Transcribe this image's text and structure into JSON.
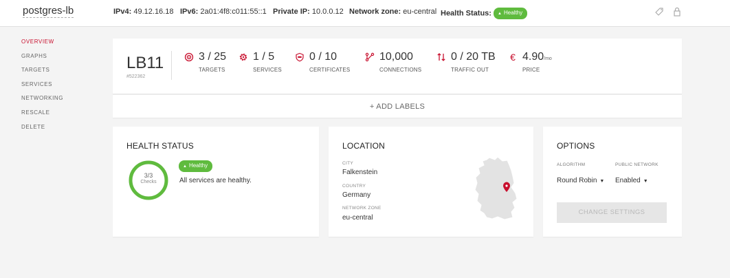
{
  "header": {
    "name": "postgres-lb",
    "ipv4_label": "IPv4:",
    "ipv4": "49.12.16.18",
    "ipv6_label": "IPv6:",
    "ipv6": "2a01:4f8:c011:55::1",
    "private_ip_label": "Private IP:",
    "private_ip": "10.0.0.12",
    "network_zone_label": "Network zone:",
    "network_zone": "eu-central",
    "health_label": "Health Status:",
    "health": "Healthy",
    "icons": [
      "label-icon",
      "lock-icon"
    ]
  },
  "sidebar": {
    "items": [
      {
        "label": "OVERVIEW",
        "active": true
      },
      {
        "label": "GRAPHS"
      },
      {
        "label": "TARGETS"
      },
      {
        "label": "SERVICES"
      },
      {
        "label": "NETWORKING"
      },
      {
        "label": "RESCALE"
      },
      {
        "label": "DELETE"
      }
    ]
  },
  "summary": {
    "type": "LB11",
    "id": "#522362",
    "stats": [
      {
        "value": "3 / 25",
        "label": "TARGETS",
        "icon": "target-icon"
      },
      {
        "value": "1 / 5",
        "label": "SERVICES",
        "icon": "services-gear-icon"
      },
      {
        "value": "0 / 10",
        "label": "CERTIFICATES",
        "icon": "certificate-shield-icon"
      },
      {
        "value": "10,000",
        "label": "CONNECTIONS",
        "icon": "connections-icon"
      },
      {
        "value": "0 / 20 TB",
        "label": "TRAFFIC OUT",
        "icon": "traffic-arrows-icon"
      },
      {
        "value": "4.90",
        "unit": "/mo",
        "label": "PRICE",
        "icon": "euro-icon"
      }
    ]
  },
  "labels": {
    "add": "+ ADD LABELS"
  },
  "health": {
    "title": "HEALTH STATUS",
    "ring_value": "3/3",
    "ring_sub": "Checks",
    "ring_fraction": 1,
    "badge": "Healthy",
    "message": "All services are healthy."
  },
  "location": {
    "title": "LOCATION",
    "city_label": "CITY",
    "city": "Falkenstein",
    "country_label": "COUNTRY",
    "country": "Germany",
    "zone_label": "NETWORK ZONE",
    "zone": "eu-central"
  },
  "options": {
    "title": "OPTIONS",
    "algorithm_label": "ALGORITHM",
    "algorithm": "Round Robin",
    "public_network_label": "PUBLIC NETWORK",
    "public_network": "Enabled",
    "button": "CHANGE SETTINGS"
  },
  "colors": {
    "accent": "#c8102e",
    "healthy": "#5fbb3e",
    "background": "#f4f4f4"
  }
}
